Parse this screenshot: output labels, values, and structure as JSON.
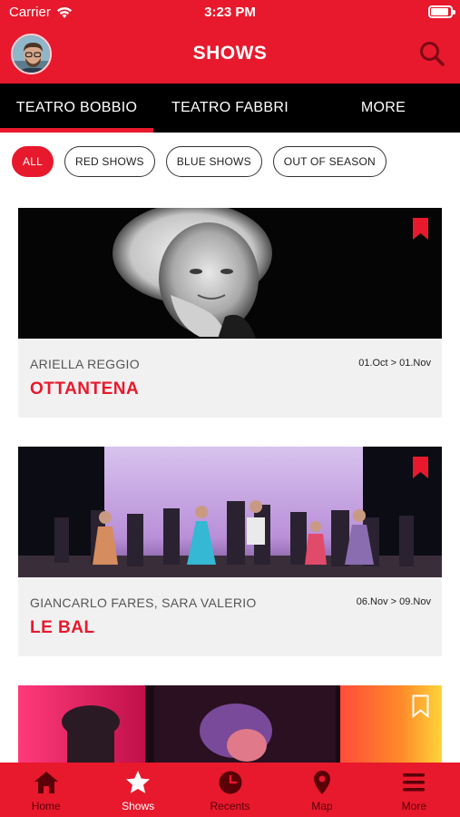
{
  "status_bar": {
    "carrier": "Carrier",
    "time": "3:23 PM"
  },
  "nav": {
    "title": "SHOWS"
  },
  "venue_tabs": [
    {
      "label": "TEATRO BOBBIO",
      "active": true
    },
    {
      "label": "TEATRO FABBRI",
      "active": false
    },
    {
      "label": "MORE",
      "active": false
    }
  ],
  "filters": [
    "ALL",
    "RED SHOWS",
    "BLUE SHOWS",
    "OUT OF SEASON"
  ],
  "active_filter": "ALL",
  "shows": [
    {
      "artist": "ARIELLA REGGIO",
      "dates": "01.Oct > 01.Nov",
      "title": "OTTANTENA",
      "bookmarked": true
    },
    {
      "artist": "GIANCARLO FARES, SARA VALERIO",
      "dates": "06.Nov > 09.Nov",
      "title": "LE BAL",
      "bookmarked": true
    },
    {
      "bookmarked": false
    }
  ],
  "bottom_tabs": [
    {
      "label": "Home",
      "icon": "home-icon",
      "active": false
    },
    {
      "label": "Shows",
      "icon": "star-icon",
      "active": true
    },
    {
      "label": "Recents",
      "icon": "clock-icon",
      "active": false
    },
    {
      "label": "Map",
      "icon": "map-pin-icon",
      "active": false
    },
    {
      "label": "More",
      "icon": "menu-icon",
      "active": false
    }
  ],
  "colors": {
    "brand_red": "#e8192c",
    "tab_bar_black": "#000000",
    "card_bg": "#f1f1f1"
  }
}
